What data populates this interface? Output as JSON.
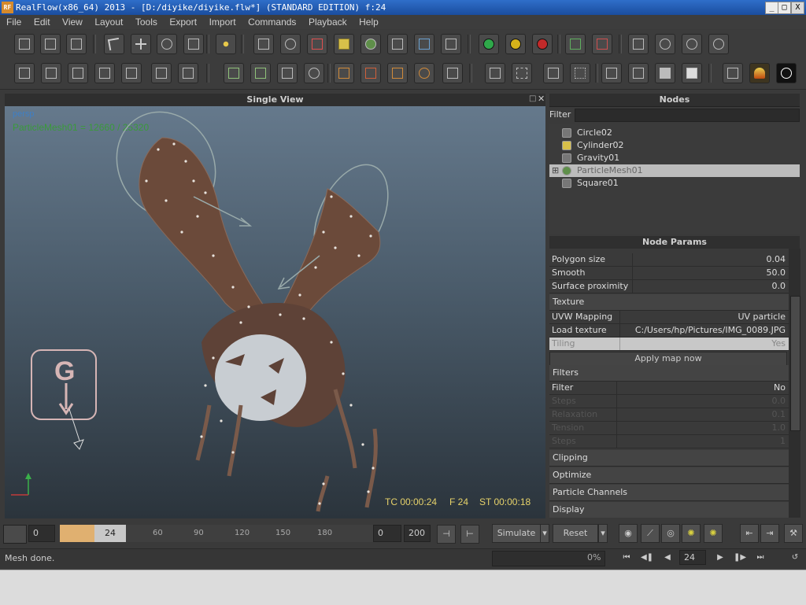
{
  "window": {
    "title": "RealFlow(x86_64) 2013 - [D:/diyike/diyike.flw*] (STANDARD EDITION) f:24",
    "app_icon": "RF",
    "minimize": "_",
    "maximize": "□",
    "close": "X"
  },
  "menu": [
    "File",
    "Edit",
    "View",
    "Layout",
    "Tools",
    "Export",
    "Import",
    "Commands",
    "Playback",
    "Help"
  ],
  "viewport": {
    "title": "Single View",
    "camera": "persp",
    "info": "ParticleMesh01 = 12660 / 25320",
    "gravity_letter": "G",
    "tc": "TC 00:00:24",
    "frame": "F 24",
    "st": "ST 00:00:18"
  },
  "nodes": {
    "title": "Nodes",
    "filter_label": "Filter",
    "items": [
      "Circle02",
      "Cylinder02",
      "Gravity01",
      "ParticleMesh01",
      "Square01"
    ]
  },
  "params": {
    "title": "Node Params",
    "rows1": [
      {
        "k": "Polygon size",
        "v": "0.04"
      },
      {
        "k": "Smooth",
        "v": "50.0"
      },
      {
        "k": "Surface proximity",
        "v": "0.0"
      }
    ],
    "texture_section": "Texture",
    "texture_rows": [
      {
        "k": "UVW Mapping",
        "v": "UV particle"
      },
      {
        "k": "Load texture",
        "v": "C:/Users/hp/Pictures/IMG_0089.JPG"
      },
      {
        "k": "Tiling",
        "v": "Yes"
      }
    ],
    "apply_map": "Apply map now",
    "filters_section": "Filters",
    "filter_row": {
      "k": "Filter",
      "v": "No"
    },
    "disabled_rows": [
      {
        "k": "Steps",
        "v": "0.0"
      },
      {
        "k": "Relaxation",
        "v": "0.1"
      },
      {
        "k": "Tension",
        "v": "1.0"
      },
      {
        "k": "Steps",
        "v": "1"
      }
    ],
    "sections": [
      "Clipping",
      "Optimize",
      "Particle Channels",
      "Display"
    ]
  },
  "timeline": {
    "start": "0",
    "current": "24",
    "ticks": [
      "60",
      "90",
      "120",
      "150",
      "180"
    ],
    "range_start": "0",
    "range_end": "200",
    "simulate": "Simulate",
    "reset": "Reset",
    "frame_field": "24"
  },
  "status": {
    "message": "Mesh done.",
    "progress": "0%"
  }
}
